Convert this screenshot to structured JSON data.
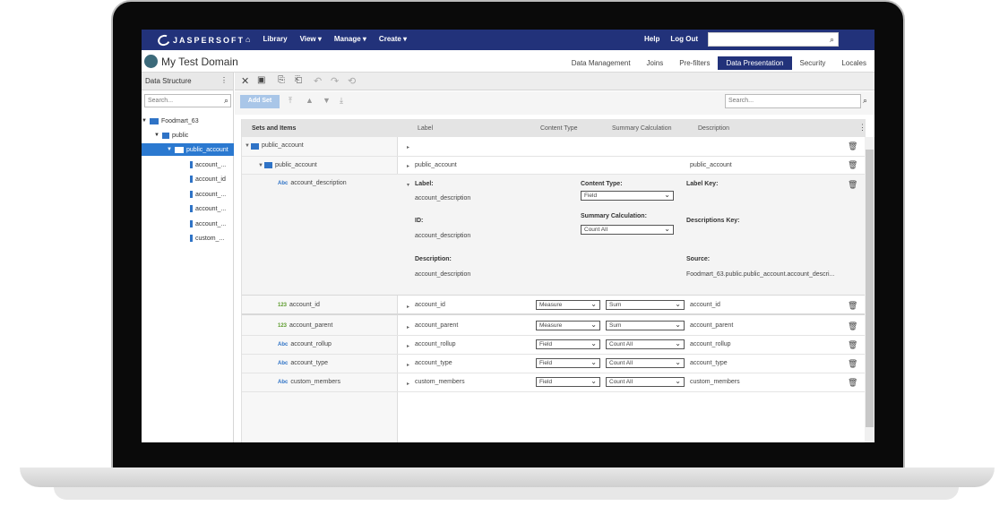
{
  "header": {
    "logo_text": "JASPERSOFT",
    "nav": [
      "Library",
      "View ▾",
      "Manage ▾",
      "Create ▾"
    ],
    "links": [
      "Help",
      "Log Out"
    ]
  },
  "titlebar": {
    "title": "My Test Domain",
    "tabs": [
      "Data Management",
      "Joins",
      "Pre-filters",
      "Data Presentation",
      "Security",
      "Locales"
    ],
    "active_tab": "Data Presentation"
  },
  "left_panel": {
    "title": "Data Structure",
    "search_placeholder": "Search...",
    "tree": [
      {
        "label": "Foodmart_63",
        "level": 0
      },
      {
        "label": "public",
        "level": 1
      },
      {
        "label": "public_account",
        "level": 2,
        "selected": true
      },
      {
        "label": "account_...",
        "level": 3
      },
      {
        "label": "account_id",
        "level": 3
      },
      {
        "label": "account_...",
        "level": 3
      },
      {
        "label": "account_...",
        "level": 3
      },
      {
        "label": "account_...",
        "level": 3
      },
      {
        "label": "custom_...",
        "level": 3
      }
    ]
  },
  "work": {
    "add_set": "Add Set",
    "search_placeholder": "Search..."
  },
  "grid": {
    "columns": {
      "sets": "Sets and Items",
      "label": "Label",
      "content_type": "Content Type",
      "summary": "Summary Calculation",
      "description": "Description"
    },
    "set_row": {
      "name": "public_account"
    },
    "subset_row": {
      "name": "public_account",
      "label": "public_account",
      "description": "public_account"
    },
    "detail": {
      "item": "account_description",
      "label_title": "Label:",
      "label_value": "account_description",
      "id_title": "ID:",
      "id_value": "account_description",
      "desc_title": "Description:",
      "desc_value": "account_description",
      "content_type_title": "Content Type:",
      "content_type_value": "Field",
      "summary_title": "Summary Calculation:",
      "summary_value": "Count All",
      "label_key_title": "Label Key:",
      "desc_key_title": "Descriptions Key:",
      "source_title": "Source:",
      "source_value": "Foodmart_63.public.public_account.account_descri..."
    },
    "items": [
      {
        "name": "account_id",
        "type": "num",
        "label": "account_id",
        "content": "Measure",
        "summary": "Sum",
        "description": "account_id"
      },
      {
        "name": "account_parent",
        "type": "num",
        "label": "account_parent",
        "content": "Measure",
        "summary": "Sum",
        "description": "account_parent"
      },
      {
        "name": "account_rollup",
        "type": "abc",
        "label": "account_rollup",
        "content": "Field",
        "summary": "Count All",
        "description": "account_rollup"
      },
      {
        "name": "account_type",
        "type": "abc",
        "label": "account_type",
        "content": "Field",
        "summary": "Count All",
        "description": "account_type"
      },
      {
        "name": "custom_members",
        "type": "abc",
        "label": "custom_members",
        "content": "Field",
        "summary": "Count All",
        "description": "custom_members"
      }
    ],
    "type_badges": {
      "abc": "Abc",
      "num": "123"
    }
  }
}
